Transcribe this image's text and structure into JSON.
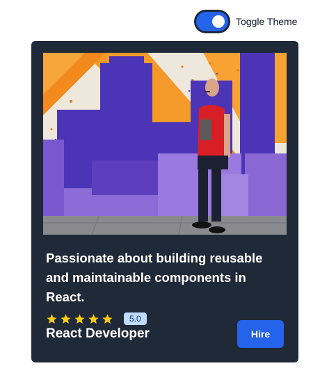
{
  "theme_toggle": {
    "label": "Toggle Theme",
    "state": "on",
    "accent_color": "#2563eb"
  },
  "card": {
    "image_alt": "Man in red t-shirt standing in front of a purple and orange skyline mural",
    "description": "Passionate about building reusable and maintainable components in React.",
    "rating": {
      "stars": 5,
      "max_stars": 5,
      "value": "5.0",
      "star_color": "#facc15"
    },
    "role": "React Developer",
    "hire_label": "Hire",
    "background_color": "#1f2937",
    "button_color": "#2563eb"
  }
}
